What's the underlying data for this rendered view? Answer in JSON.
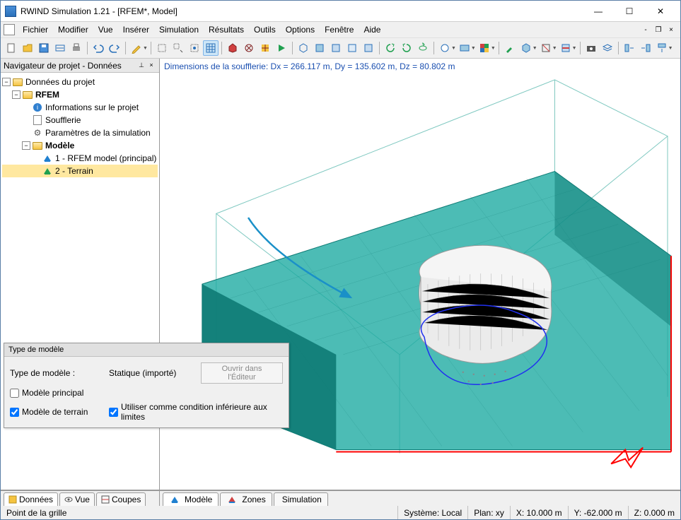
{
  "window": {
    "title": "RWIND Simulation 1.21 - [RFEM*, Model]"
  },
  "menu": {
    "items": [
      "Fichier",
      "Modifier",
      "Vue",
      "Insérer",
      "Simulation",
      "Résultats",
      "Outils",
      "Options",
      "Fenêtre",
      "Aide"
    ]
  },
  "navigator": {
    "title": "Navigateur de projet - Données",
    "root": "Données du projet",
    "rfem": "RFEM",
    "info": "Informations sur le projet",
    "soufflerie": "Soufflerie",
    "params": "Paramètres de la simulation",
    "modele": "Modèle",
    "model1": "1 - RFEM model (principal)",
    "model2": "2 - Terrain"
  },
  "viewport": {
    "dims": "Dimensions de la soufflerie:  Dx = 266.117 m, Dy = 135.602 m, Dz = 80.802 m"
  },
  "overlay": {
    "title": "Type de modèle",
    "label_type": "Type de modèle :",
    "value_type": "Statique (importé)",
    "btn_open": "Ouvrir dans l'Éditeur",
    "chk_principal": "Modèle principal",
    "chk_terrain": "Modèle de terrain",
    "chk_cond": "Utiliser comme condition inférieure aux limites"
  },
  "nav_tabs": {
    "donnees": "Données",
    "vue": "Vue",
    "coupes": "Coupes"
  },
  "view_tabs": {
    "modele": "Modèle",
    "zones": "Zones",
    "simulation": "Simulation"
  },
  "status": {
    "msg": "Point de la grille",
    "sys": "Système: Local",
    "plan": "Plan: xy",
    "x": "X: 10.000 m",
    "y": "Y: -62.000 m",
    "z": "Z: 0.000 m"
  }
}
